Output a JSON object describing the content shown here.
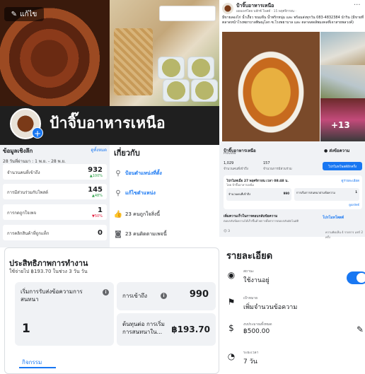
{
  "cover": {
    "edit_label": "แก้ไข",
    "page_name": "ป้าจิ๊บอาหารเหนือ",
    "more_photos": "+13"
  },
  "insights": {
    "title": "ข้อมูลเชิงลึก",
    "see_all": "ดูทั้งหมด",
    "range": "28 วันที่ผ่านมา : 1 พ.ย. - 28 พ.ย.",
    "metrics": [
      {
        "label": "จำนวนคนที่เข้าถึง",
        "value": "932",
        "change": "▲100%"
      },
      {
        "label": "การมีส่วนร่วมกับโพสต์",
        "value": "145",
        "change": "▲48%"
      },
      {
        "label": "การกดถูกใจเพจ",
        "value": "1",
        "change": "▼50%"
      },
      {
        "label": "การคลิกสินค้าที่ถูกแท็ก",
        "value": "0",
        "change": ""
      }
    ]
  },
  "about": {
    "title": "เกี่ยวกับ",
    "rows": [
      {
        "icon": "pin-icon",
        "text": "ป้อนตำแหน่งที่ตั้ง",
        "link": true
      },
      {
        "icon": "pin-icon",
        "text": "แก้ไขตำแหน่ง",
        "link": true
      },
      {
        "icon": "thumbs-up-icon",
        "text": "23 คนถูกใจสิ่งนี้",
        "link": false
      },
      {
        "icon": "rss-icon",
        "text": "23 คนติดตามเพจนี้",
        "link": false
      }
    ]
  },
  "performance": {
    "title": "ประสิทธิภาพการทำงาน",
    "subtitle": "ใช้จ่ายไป ฿193.70 ในช่วง 3 วัน วัน",
    "cards": [
      {
        "label": "เริ่มการรับส่งข้อความการสนทนา",
        "value": "1"
      },
      {
        "label": "การเข้าถึง",
        "value": "990"
      },
      {
        "label": "ต้นทุนต่อ การเริ่มการสนทนาใน...",
        "value": "฿193.70"
      }
    ],
    "tab": "กิจกรรม"
  },
  "post": {
    "author": "ป้าจิ๊บอาหารเหนือ",
    "meta": "เผยแพร่โดย บอ๊กซ์ โพสต์ · 15 พฤศจิกายน ·",
    "text": "มีขายลองไก่ น้ำเงี้ยว ขนมจีน น้ำพริกหนุ่ม และ พร้อมส่งทุกวัน 083-4832384 นำริน (มีขายที่ตลาดหน้าโรงพยาบาลพิษณุโลก ซ.โรงพยาบาล และ ตลาดสดลัพมงคลที่เจาสายพลวงค์)"
  },
  "midcard": {
    "name": "ป้าจิ๊บอาหารเหนือ",
    "sub": "Preview",
    "message_btn": "ส่งข้อความ",
    "stats": [
      {
        "value": "1,029",
        "label": "จำนวนคนที่เข้าถึง"
      },
      {
        "value": "157",
        "label": "จำนวนการมีส่วนร่วม"
      }
    ],
    "boost_btn": "โปรโมทโพสต์อีกครั้ง",
    "inner_title": "โปรโมทเมื่อ 27 พฤศจิกายน เวลา 08:48 น.",
    "inner_sub": "โดย ป้าจิ๊บอาหารเหนือ",
    "inner_see": "ดูรายละเอียด",
    "inner_m1_label": "จำนวนคนที่เข้าถึง",
    "inner_m1_value": "990",
    "inner_m2_label": "การเริ่มการสนทนาผ่านข้อความ",
    "inner_m2_value": "1",
    "inner_foot": "ดูผลลัพธ์",
    "cta_title": "เพิ่มความเร็วในการตอบกลับข้อความ",
    "cta_sub": "ตอบกลับข้อความได้เร็วขึ้นด้วยการตั้งค่าการตอบกลับอัตโนมัติ",
    "cta_btn": "โปรโมทโพสต์",
    "reacts": "😊 3",
    "reacts_right": "ความคิดเห็น 4 รายการ แชร์ 2 ครั้ง"
  },
  "details": {
    "title": "รายละเอียด",
    "rows": [
      {
        "icon": "status-icon",
        "label": "สถานะ",
        "value": "ใช้งานอยู่"
      },
      {
        "icon": "flag-icon",
        "label": "เป้าหมาย",
        "value": "เพิ่มจำนวนข้อความ"
      },
      {
        "icon": "money-icon",
        "label": "งบประมาณทั้งหมด",
        "value": "฿500.00"
      },
      {
        "icon": "clock-icon",
        "label": "ระยะเวลา",
        "value": "7 วัน"
      }
    ]
  }
}
